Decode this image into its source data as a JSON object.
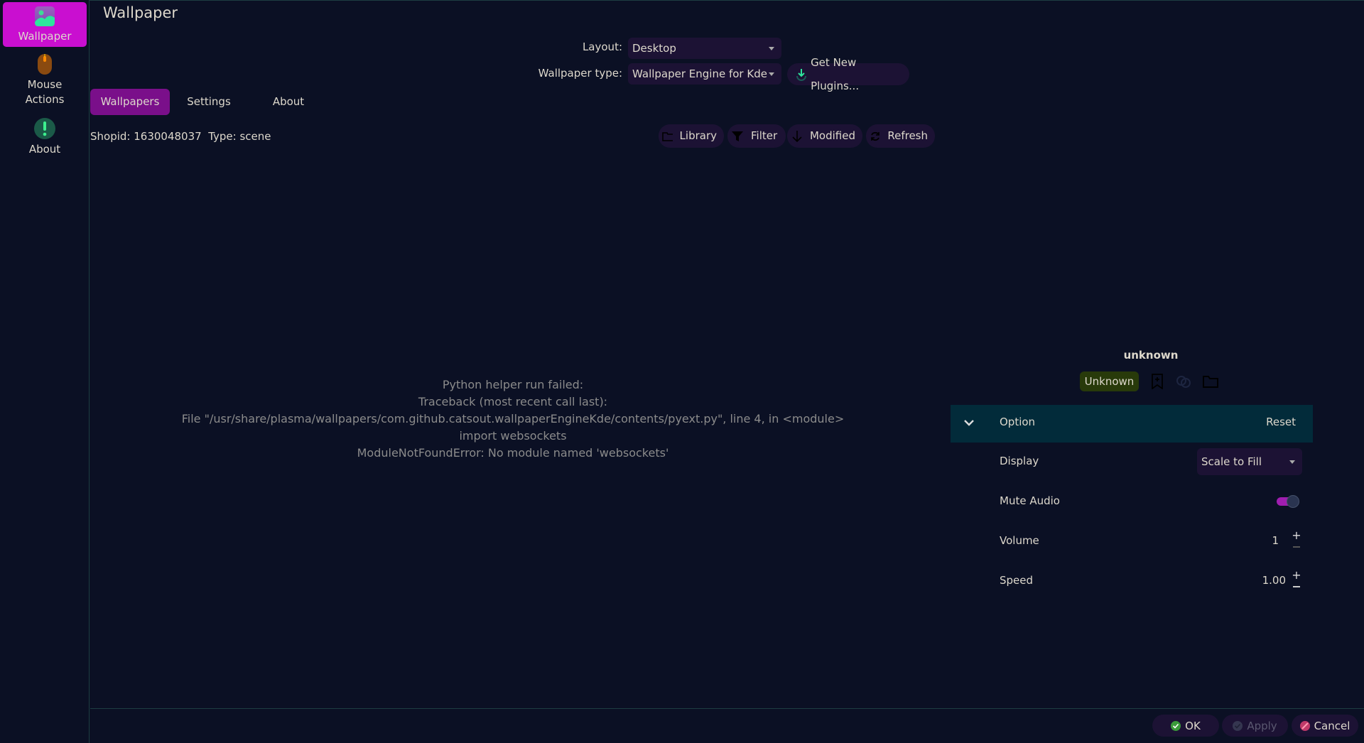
{
  "sidebar": {
    "items": [
      {
        "label": "Wallpaper",
        "icon": "image-icon"
      },
      {
        "label": "Mouse\nActions",
        "line1": "Mouse",
        "line2": "Actions",
        "icon": "mouse-icon"
      },
      {
        "label": "About",
        "icon": "info-icon"
      }
    ]
  },
  "header": {
    "title": "Wallpaper"
  },
  "layout": {
    "label": "Layout:",
    "value": "Desktop"
  },
  "wallpaper_type": {
    "label": "Wallpaper type:",
    "value": "Wallpaper Engine for Kde"
  },
  "get_plugins": "Get New Plugins...",
  "tabs": [
    "Wallpapers",
    "Settings",
    "About"
  ],
  "info": "Shopid: 1630048037  Type: scene",
  "toolbar": {
    "library": "Library",
    "filter": "Filter",
    "modified": "Modified",
    "refresh": "Refresh"
  },
  "error": [
    "Python helper run failed:",
    "Traceback (most recent call last):",
    "File \"/usr/share/plasma/wallpapers/com.github.catsout.wallpaperEngineKde/contents/pyext.py\", line 4, in <module>",
    "import websockets",
    "ModuleNotFoundError: No module named 'websockets'"
  ],
  "panel": {
    "name": "unknown",
    "badge": "Unknown",
    "option": "Option",
    "reset": "Reset",
    "display": {
      "label": "Display",
      "value": "Scale to Fill"
    },
    "mute": {
      "label": "Mute Audio",
      "on": true
    },
    "volume": {
      "label": "Volume",
      "value": "1"
    },
    "speed": {
      "label": "Speed",
      "value": "1.00"
    }
  },
  "footer": {
    "ok": "OK",
    "apply": "Apply",
    "cancel": "Cancel"
  },
  "colors": {
    "accent": "#c90fd0",
    "tab_active": "#7a0f8a",
    "header": "#022b3a",
    "badge": "#283a0a"
  }
}
